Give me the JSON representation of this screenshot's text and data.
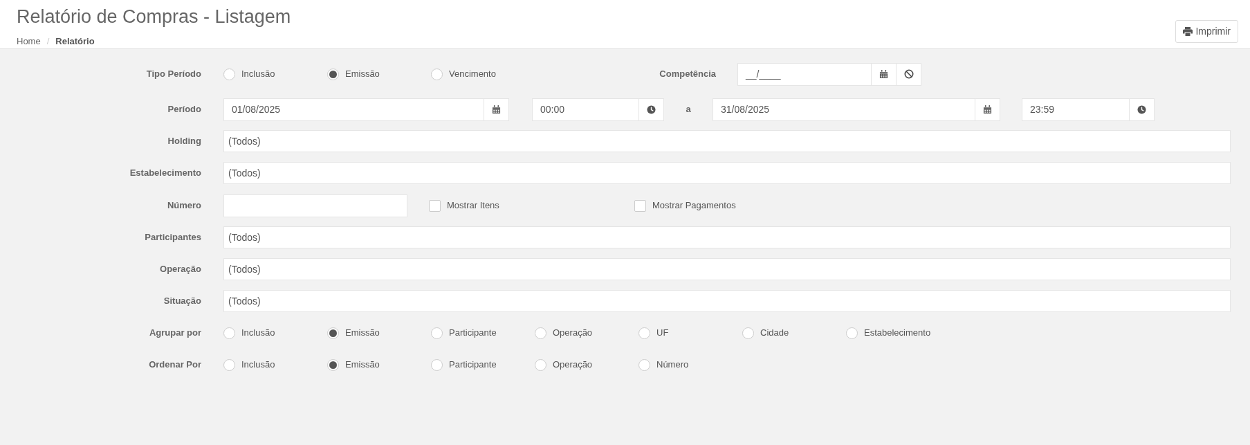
{
  "header": {
    "title": "Relatório de Compras - Listagem",
    "breadcrumb": [
      {
        "label": "Home",
        "current": false
      },
      {
        "label": "Relatório",
        "current": true
      }
    ],
    "breadcrumb_separator": "/",
    "print_button": "Imprimir"
  },
  "rows": [
    {
      "kind": "radio",
      "label": "Tipo Período",
      "options": [
        {
          "label": "Inclusão",
          "selected": false
        },
        {
          "label": "Emissão",
          "selected": true
        },
        {
          "label": "Vencimento",
          "selected": false
        }
      ],
      "competencia": {
        "label": "Competência",
        "placeholder": "__/____"
      }
    },
    {
      "kind": "period",
      "label": "Período",
      "start_date": "01/08/2025",
      "start_time": "00:00",
      "separator": "a",
      "end_date": "31/08/2025",
      "end_time": "23:59"
    },
    {
      "kind": "select",
      "label": "Holding",
      "value": "(Todos)"
    },
    {
      "kind": "select",
      "label": "Estabelecimento",
      "value": "(Todos)"
    },
    {
      "kind": "number",
      "label": "Número",
      "checkboxes": [
        {
          "label": "Mostrar Itens",
          "checked": false
        },
        {
          "label": "Mostrar Pagamentos",
          "checked": false
        }
      ]
    },
    {
      "kind": "select",
      "label": "Participantes",
      "value": "(Todos)"
    },
    {
      "kind": "select",
      "label": "Operação",
      "value": "(Todos)"
    },
    {
      "kind": "select",
      "label": "Situação",
      "value": "(Todos)"
    },
    {
      "kind": "radio",
      "label": "Agrupar por",
      "options": [
        {
          "label": "Inclusão",
          "selected": false
        },
        {
          "label": "Emissão",
          "selected": true
        },
        {
          "label": "Participante",
          "selected": false
        },
        {
          "label": "Operação",
          "selected": false
        },
        {
          "label": "UF",
          "selected": false
        },
        {
          "label": "Cidade",
          "selected": false
        },
        {
          "label": "Estabelecimento",
          "selected": false
        }
      ]
    },
    {
      "kind": "radio",
      "label": "Ordenar Por",
      "options": [
        {
          "label": "Inclusão",
          "selected": false
        },
        {
          "label": "Emissão",
          "selected": true
        },
        {
          "label": "Participante",
          "selected": false
        },
        {
          "label": "Operação",
          "selected": false
        },
        {
          "label": "Número",
          "selected": false
        }
      ]
    }
  ]
}
